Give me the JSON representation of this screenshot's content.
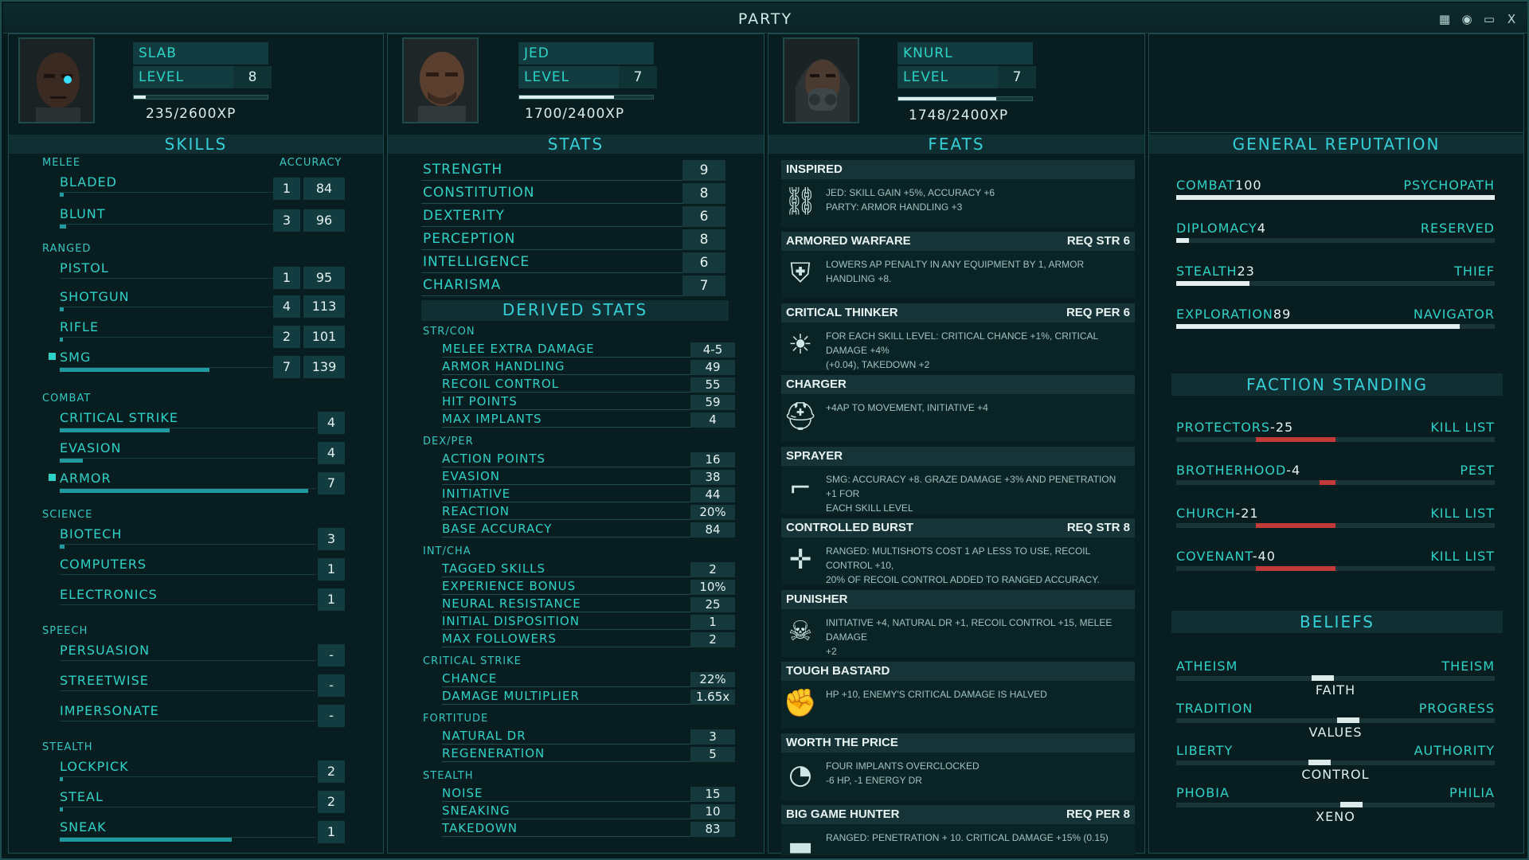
{
  "window": {
    "title": "PARTY",
    "icons": [
      "calendar-icon",
      "brain-icon",
      "screen-icon",
      "close-icon"
    ],
    "close_label": "X"
  },
  "party": [
    {
      "name": "SLAB",
      "level_label": "LEVEL",
      "level": "8",
      "xp": "235/2600XP",
      "xp_fraction": 0.09
    },
    {
      "name": "JED",
      "level_label": "LEVEL",
      "level": "7",
      "xp": "1700/2400XP",
      "xp_fraction": 0.71
    },
    {
      "name": "KNURL",
      "level_label": "LEVEL",
      "level": "7",
      "xp": "1748/2400XP",
      "xp_fraction": 0.73
    }
  ],
  "skills": {
    "title": "SKILLS",
    "accuracy_label": "ACCURACY",
    "melee": {
      "label": "MELEE",
      "items": [
        {
          "name": "BLADED",
          "rank": "1",
          "acc": "84",
          "fill": 0.02
        },
        {
          "name": "BLUNT",
          "rank": "3",
          "acc": "96",
          "fill": 0.03
        }
      ]
    },
    "ranged": {
      "label": "RANGED",
      "items": [
        {
          "name": "PISTOL",
          "rank": "1",
          "acc": "95",
          "fill": 0.0
        },
        {
          "name": "SHOTGUN",
          "rank": "4",
          "acc": "113",
          "fill": 0.02
        },
        {
          "name": "RIFLE",
          "rank": "2",
          "acc": "101",
          "fill": 0.01
        },
        {
          "name": "SMG",
          "rank": "7",
          "acc": "139",
          "fill": 0.7
        }
      ]
    },
    "combat": {
      "label": "COMBAT",
      "items": [
        {
          "name": "CRITICAL STRIKE",
          "rank": "4",
          "fill": 0.43
        },
        {
          "name": "EVASION",
          "rank": "4",
          "fill": 0.09
        },
        {
          "name": "ARMOR",
          "rank": "7",
          "fill": 0.97
        }
      ]
    },
    "science": {
      "label": "SCIENCE",
      "items": [
        {
          "name": "BIOTECH",
          "rank": "3",
          "fill": 0.02
        },
        {
          "name": "COMPUTERS",
          "rank": "1",
          "fill": 0.0
        },
        {
          "name": "ELECTRONICS",
          "rank": "1",
          "fill": 0.0
        }
      ]
    },
    "speech": {
      "label": "SPEECH",
      "items": [
        {
          "name": "PERSUASION",
          "rank": "-"
        },
        {
          "name": "STREETWISE",
          "rank": "-"
        },
        {
          "name": "IMPERSONATE",
          "rank": "-"
        }
      ]
    },
    "stealth": {
      "label": "STEALTH",
      "items": [
        {
          "name": "LOCKPICK",
          "rank": "2",
          "fill": 0.01
        },
        {
          "name": "STEAL",
          "rank": "2",
          "fill": 0.01
        },
        {
          "name": "SNEAK",
          "rank": "1",
          "fill": 0.67
        }
      ]
    }
  },
  "stats": {
    "title": "STATS",
    "items": [
      {
        "name": "STRENGTH",
        "value": "9"
      },
      {
        "name": "CONSTITUTION",
        "value": "8"
      },
      {
        "name": "DEXTERITY",
        "value": "6"
      },
      {
        "name": "PERCEPTION",
        "value": "8"
      },
      {
        "name": "INTELLIGENCE",
        "value": "6"
      },
      {
        "name": "CHARISMA",
        "value": "7"
      }
    ],
    "derived_title": "DERIVED STATS",
    "groups": [
      {
        "label": "STR/CON",
        "items": [
          {
            "name": "MELEE EXTRA DAMAGE",
            "value": "4-5"
          },
          {
            "name": "ARMOR HANDLING",
            "value": "49"
          },
          {
            "name": "RECOIL CONTROL",
            "value": "55"
          },
          {
            "name": "HIT POINTS",
            "value": "59"
          },
          {
            "name": "MAX IMPLANTS",
            "value": "4"
          }
        ]
      },
      {
        "label": "DEX/PER",
        "items": [
          {
            "name": "ACTION POINTS",
            "value": "16"
          },
          {
            "name": "EVASION",
            "value": "38"
          },
          {
            "name": "INITIATIVE",
            "value": "44"
          },
          {
            "name": "REACTION",
            "value": "20%"
          },
          {
            "name": "BASE ACCURACY",
            "value": "84"
          }
        ]
      },
      {
        "label": "INT/CHA",
        "items": [
          {
            "name": "TAGGED SKILLS",
            "value": "2"
          },
          {
            "name": "EXPERIENCE BONUS",
            "value": "10%"
          },
          {
            "name": "NEURAL RESISTANCE",
            "value": "25"
          },
          {
            "name": "INITIAL DISPOSITION",
            "value": "1"
          },
          {
            "name": "MAX FOLLOWERS",
            "value": "2"
          }
        ]
      },
      {
        "label": "CRITICAL STRIKE",
        "items": [
          {
            "name": "CHANCE",
            "value": "22%"
          },
          {
            "name": "DAMAGE MULTIPLIER",
            "value": "1.65x"
          }
        ]
      },
      {
        "label": "FORTITUDE",
        "items": [
          {
            "name": "NATURAL DR",
            "value": "3"
          },
          {
            "name": "REGENERATION",
            "value": "5"
          }
        ]
      },
      {
        "label": "STEALTH",
        "items": [
          {
            "name": "NOISE",
            "value": "15"
          },
          {
            "name": "SNEAKING",
            "value": "10"
          },
          {
            "name": "TAKEDOWN",
            "value": "83"
          }
        ]
      }
    ]
  },
  "feats": {
    "title": "FEATS",
    "items": [
      {
        "name": "INSPIRED",
        "req": "",
        "icon": "chain-link-icon",
        "desc1": "JED: SKILL GAIN +5%, ACCURACY +6",
        "desc2": "PARTY: ARMOR HANDLING +3"
      },
      {
        "name": "ARMORED WARFARE",
        "req": "REQ STR 6",
        "icon": "armor-icon",
        "desc1": "LOWERS AP PENALTY IN ANY EQUIPMENT BY 1, ARMOR HANDLING +8.",
        "desc2": ""
      },
      {
        "name": "CRITICAL THINKER",
        "req": "REQ PER 6",
        "icon": "lightbulb-icon",
        "desc1": "FOR EACH SKILL LEVEL: CRITICAL CHANCE +1%, CRITICAL DAMAGE +4%",
        "desc2": "(+0.04), TAKEDOWN +2"
      },
      {
        "name": "CHARGER",
        "req": "",
        "icon": "helmet-icon",
        "desc1": "+4AP TO MOVEMENT, INITIATIVE +4",
        "desc2": ""
      },
      {
        "name": "SPRAYER",
        "req": "",
        "icon": "smg-icon",
        "desc1": "SMG: ACCURACY +8. GRAZE DAMAGE +3% AND PENETRATION +1 FOR",
        "desc2": "EACH SKILL LEVEL"
      },
      {
        "name": "CONTROLLED BURST",
        "req": "REQ STR 8",
        "icon": "crosshair-icon",
        "desc1": "RANGED: MULTISHOTS COST 1 AP LESS TO USE, RECOIL CONTROL +10,",
        "desc2": "20% OF RECOIL CONTROL ADDED TO RANGED ACCURACY."
      },
      {
        "name": "PUNISHER",
        "req": "",
        "icon": "skull-icon",
        "desc1": "INITIATIVE +4, NATURAL DR +1, RECOIL CONTROL +15, MELEE DAMAGE",
        "desc2": "+2"
      },
      {
        "name": "TOUGH BASTARD",
        "req": "",
        "icon": "fist-icon",
        "desc1": "HP +10, ENEMY'S CRITICAL DAMAGE IS HALVED",
        "desc2": ""
      },
      {
        "name": "WORTH THE PRICE",
        "req": "",
        "icon": "gauge-icon",
        "desc1": "FOUR IMPLANTS OVERCLOCKED",
        "desc2": "-6 HP, -1 ENERGY DR"
      },
      {
        "name": "BIG GAME HUNTER",
        "req": "REQ PER 8",
        "icon": "rifle-icon",
        "desc1": "RANGED: PENETRATION + 10. CRITICAL DAMAGE +15% (0.15)",
        "desc2": ""
      }
    ]
  },
  "reputation": {
    "title": "GENERAL REPUTATION",
    "items": [
      {
        "name": "COMBAT",
        "value": "100",
        "rank": "PSYCHOPATH",
        "fill": 1.0
      },
      {
        "name": "DIPLOMACY",
        "value": "4",
        "rank": "RESERVED",
        "fill": 0.04
      },
      {
        "name": "STEALTH",
        "value": "23",
        "rank": "THIEF",
        "fill": 0.23
      },
      {
        "name": "EXPLORATION",
        "value": "89",
        "rank": "NAVIGATOR",
        "fill": 0.89
      }
    ]
  },
  "factions": {
    "title": "FACTION STANDING",
    "items": [
      {
        "name": "PROTECTORS",
        "value": "-25",
        "rank": "KILL LIST",
        "fill": 0.5
      },
      {
        "name": "BROTHERHOOD",
        "value": "-4",
        "rank": "PEST",
        "fill": 0.1
      },
      {
        "name": "CHURCH",
        "value": "-21",
        "rank": "KILL LIST",
        "fill": 0.5
      },
      {
        "name": "COVENANT",
        "value": "-40",
        "rank": "KILL LIST",
        "fill": 0.5
      }
    ]
  },
  "beliefs": {
    "title": "BELIEFS",
    "items": [
      {
        "left": "ATHEISM",
        "right": "THEISM",
        "center": "FAITH",
        "pos": 0.46
      },
      {
        "left": "TRADITION",
        "right": "PROGRESS",
        "center": "VALUES",
        "pos": 0.54
      },
      {
        "left": "LIBERTY",
        "right": "AUTHORITY",
        "center": "CONTROL",
        "pos": 0.45
      },
      {
        "left": "PHOBIA",
        "right": "PHILIA",
        "center": "XENO",
        "pos": 0.55
      }
    ]
  },
  "colors": {
    "accent": "#2ed2c6",
    "bar": "#1f9aa0",
    "hostile": "#c33a3a",
    "bg": "#071b1d"
  }
}
